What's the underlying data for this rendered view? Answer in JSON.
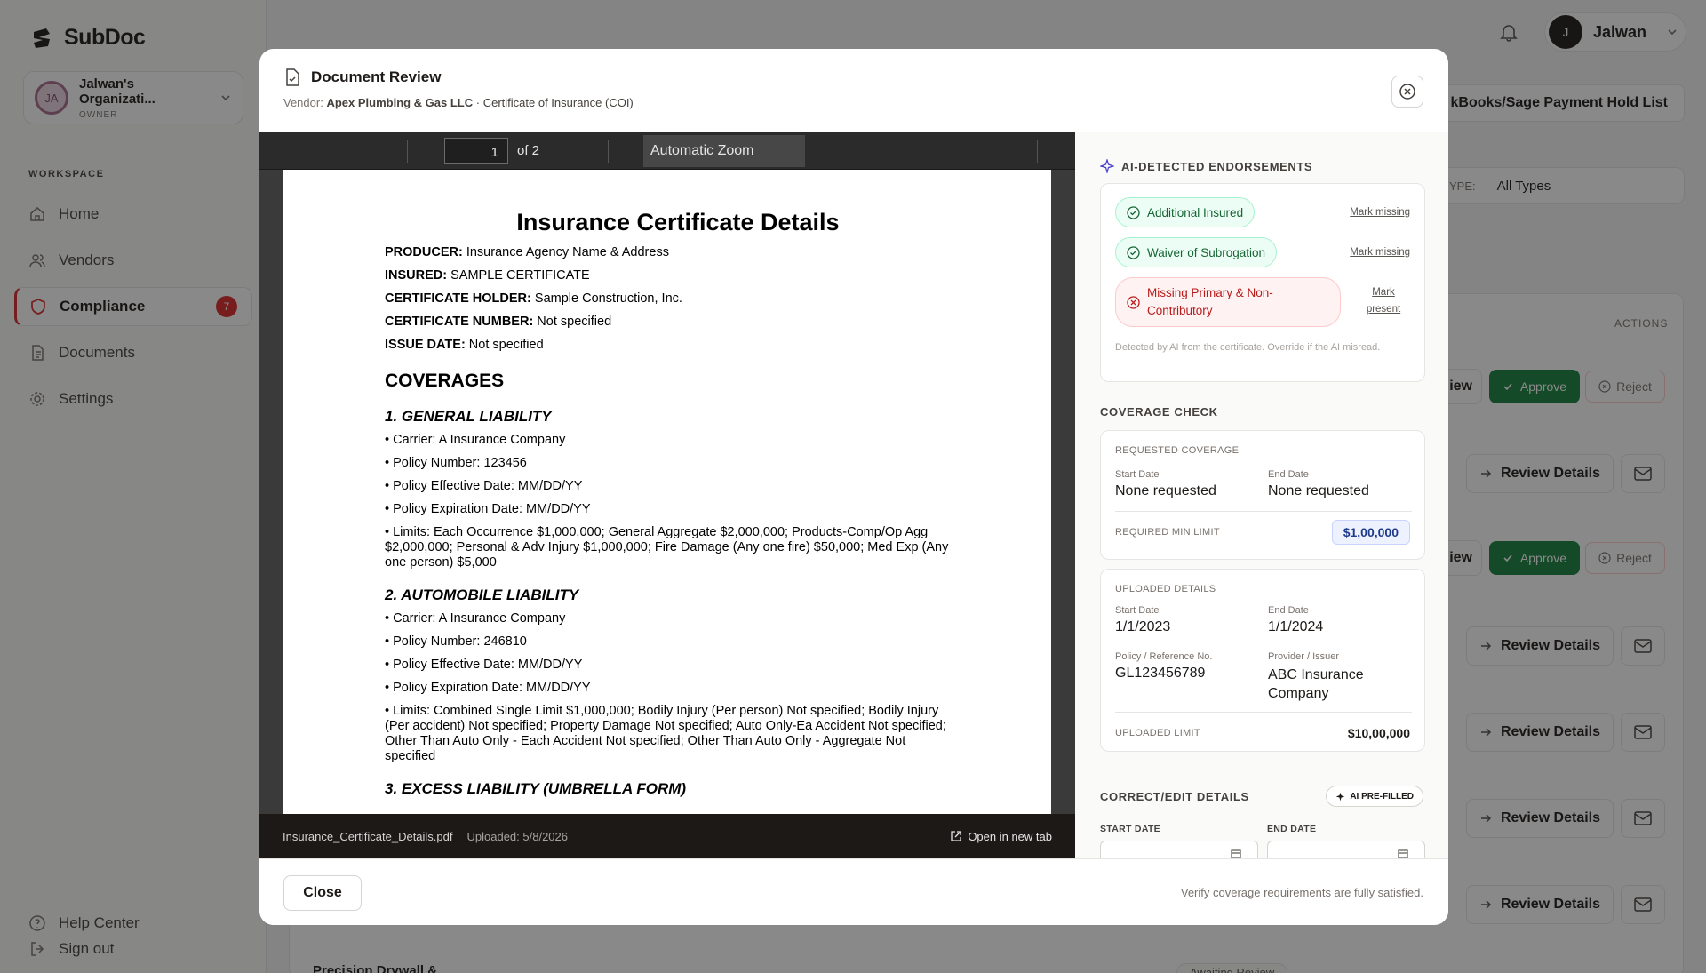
{
  "app": {
    "name": "SubDoc"
  },
  "sidebar": {
    "org": {
      "initials": "JA",
      "name": "Jalwan's Organizati...",
      "role": "OWNER"
    },
    "workspace_label": "WORKSPACE",
    "items": [
      {
        "label": "Home",
        "icon": "home-icon"
      },
      {
        "label": "Vendors",
        "icon": "users-icon"
      },
      {
        "label": "Compliance",
        "icon": "shield-icon",
        "badge": "7",
        "active": true
      },
      {
        "label": "Documents",
        "icon": "document-icon"
      },
      {
        "label": "Settings",
        "icon": "gear-icon"
      }
    ],
    "help": "Help Center",
    "signout": "Sign out"
  },
  "topbar": {
    "user_initial": "J",
    "user_name": "Jalwan"
  },
  "background": {
    "hold_list": "kBooks/Sage Payment Hold List",
    "type_label": "YPE:",
    "type_value": "All Types",
    "actions_header": "ACTIONS",
    "review_partial": "iew",
    "approve": "Approve",
    "reject": "Reject",
    "review_details": "Review Details",
    "row_partial": "Precision Drywall &",
    "status_partial": "Awaiting Review"
  },
  "modal": {
    "title": "Document Review",
    "vendor_label": "Vendor:",
    "vendor_name": "Apex Plumbing & Gas LLC",
    "doc_type": "· Certificate of Insurance (COI)",
    "viewer": {
      "page": "1",
      "of_pages": "of 2",
      "zoom": "Automatic Zoom",
      "file_name": "Insurance_Certificate_Details.pdf",
      "uploaded": "Uploaded: 5/8/2026",
      "open_new_tab": "Open in new tab"
    },
    "pdf": {
      "title": "Insurance Certificate Details",
      "header_lines": [
        {
          "k": "PRODUCER:",
          "v": " Insurance Agency Name & Address"
        },
        {
          "k": "INSURED:",
          "v": " SAMPLE CERTIFICATE"
        },
        {
          "k": "CERTIFICATE HOLDER:",
          "v": " Sample Construction, Inc."
        },
        {
          "k": "CERTIFICATE NUMBER:",
          "v": " Not specified"
        },
        {
          "k": "ISSUE DATE:",
          "v": " Not specified"
        }
      ],
      "coverages": "COVERAGES",
      "gl_title": "1. GENERAL LIABILITY",
      "gl_lines": [
        "• Carrier: A Insurance Company",
        "• Policy Number: 123456",
        "• Policy Effective Date: MM/DD/YY",
        "• Policy Expiration Date: MM/DD/YY",
        "• Limits: Each Occurrence $1,000,000; General Aggregate $2,000,000; Products-Comp/Op Agg $2,000,000; Personal & Adv Injury $1,000,000; Fire Damage (Any one fire) $50,000; Med Exp (Any one person) $5,000"
      ],
      "auto_title": "2. AUTOMOBILE LIABILITY",
      "auto_lines": [
        "• Carrier: A Insurance Company",
        "• Policy Number: 246810",
        "• Policy Effective Date: MM/DD/YY",
        "• Policy Expiration Date: MM/DD/YY",
        "• Limits: Combined Single Limit $1,000,000; Bodily Injury (Per person) Not specified; Bodily Injury (Per accident) Not specified; Property Damage Not specified; Auto Only-Ea Accident Not specified; Other Than Auto Only - Each Accident Not specified; Other Than Auto Only - Aggregate Not specified"
      ],
      "excess_title": "3. EXCESS LIABILITY (UMBRELLA FORM)"
    },
    "endorsements": {
      "title": "AI-DETECTED ENDORSEMENTS",
      "items": [
        {
          "label": "Additional Insured",
          "action": "Mark missing",
          "status": "present"
        },
        {
          "label": "Waiver of Subrogation",
          "action": "Mark missing",
          "status": "present"
        },
        {
          "label": "Missing Primary & Non-Contributory",
          "action": "Mark present",
          "status": "missing"
        }
      ],
      "note": "Detected by AI from the certificate. Override if the AI misread."
    },
    "coverage_check": {
      "title": "COVERAGE CHECK",
      "requested": {
        "heading": "REQUESTED COVERAGE",
        "start_label": "Start Date",
        "start_value": "None requested",
        "end_label": "End Date",
        "end_value": "None requested",
        "min_limit_label": "REQUIRED MIN LIMIT",
        "min_limit_value": "$1,00,000"
      },
      "uploaded": {
        "heading": "UPLOADED DETAILS",
        "start_label": "Start Date",
        "start_value": "1/1/2023",
        "end_label": "End Date",
        "end_value": "1/1/2024",
        "policy_label": "Policy / Reference No.",
        "policy_value": "GL123456789",
        "provider_label": "Provider / Issuer",
        "provider_value": "ABC Insurance Company",
        "limit_label": "UPLOADED LIMIT",
        "limit_value": "$10,00,000"
      }
    },
    "edit": {
      "title": "CORRECT/EDIT DETAILS",
      "ai_tag": "AI PRE-FILLED",
      "start_label": "START DATE",
      "end_label": "END DATE"
    },
    "footer": {
      "close": "Close",
      "note": "Verify coverage requirements are fully satisfied."
    }
  },
  "colors": {
    "accent_red": "#dc2626",
    "approve_green": "#15803d",
    "ok_green": "#166534",
    "missing_red": "#b91c1c",
    "limit_blue": "#1e3a8a"
  }
}
